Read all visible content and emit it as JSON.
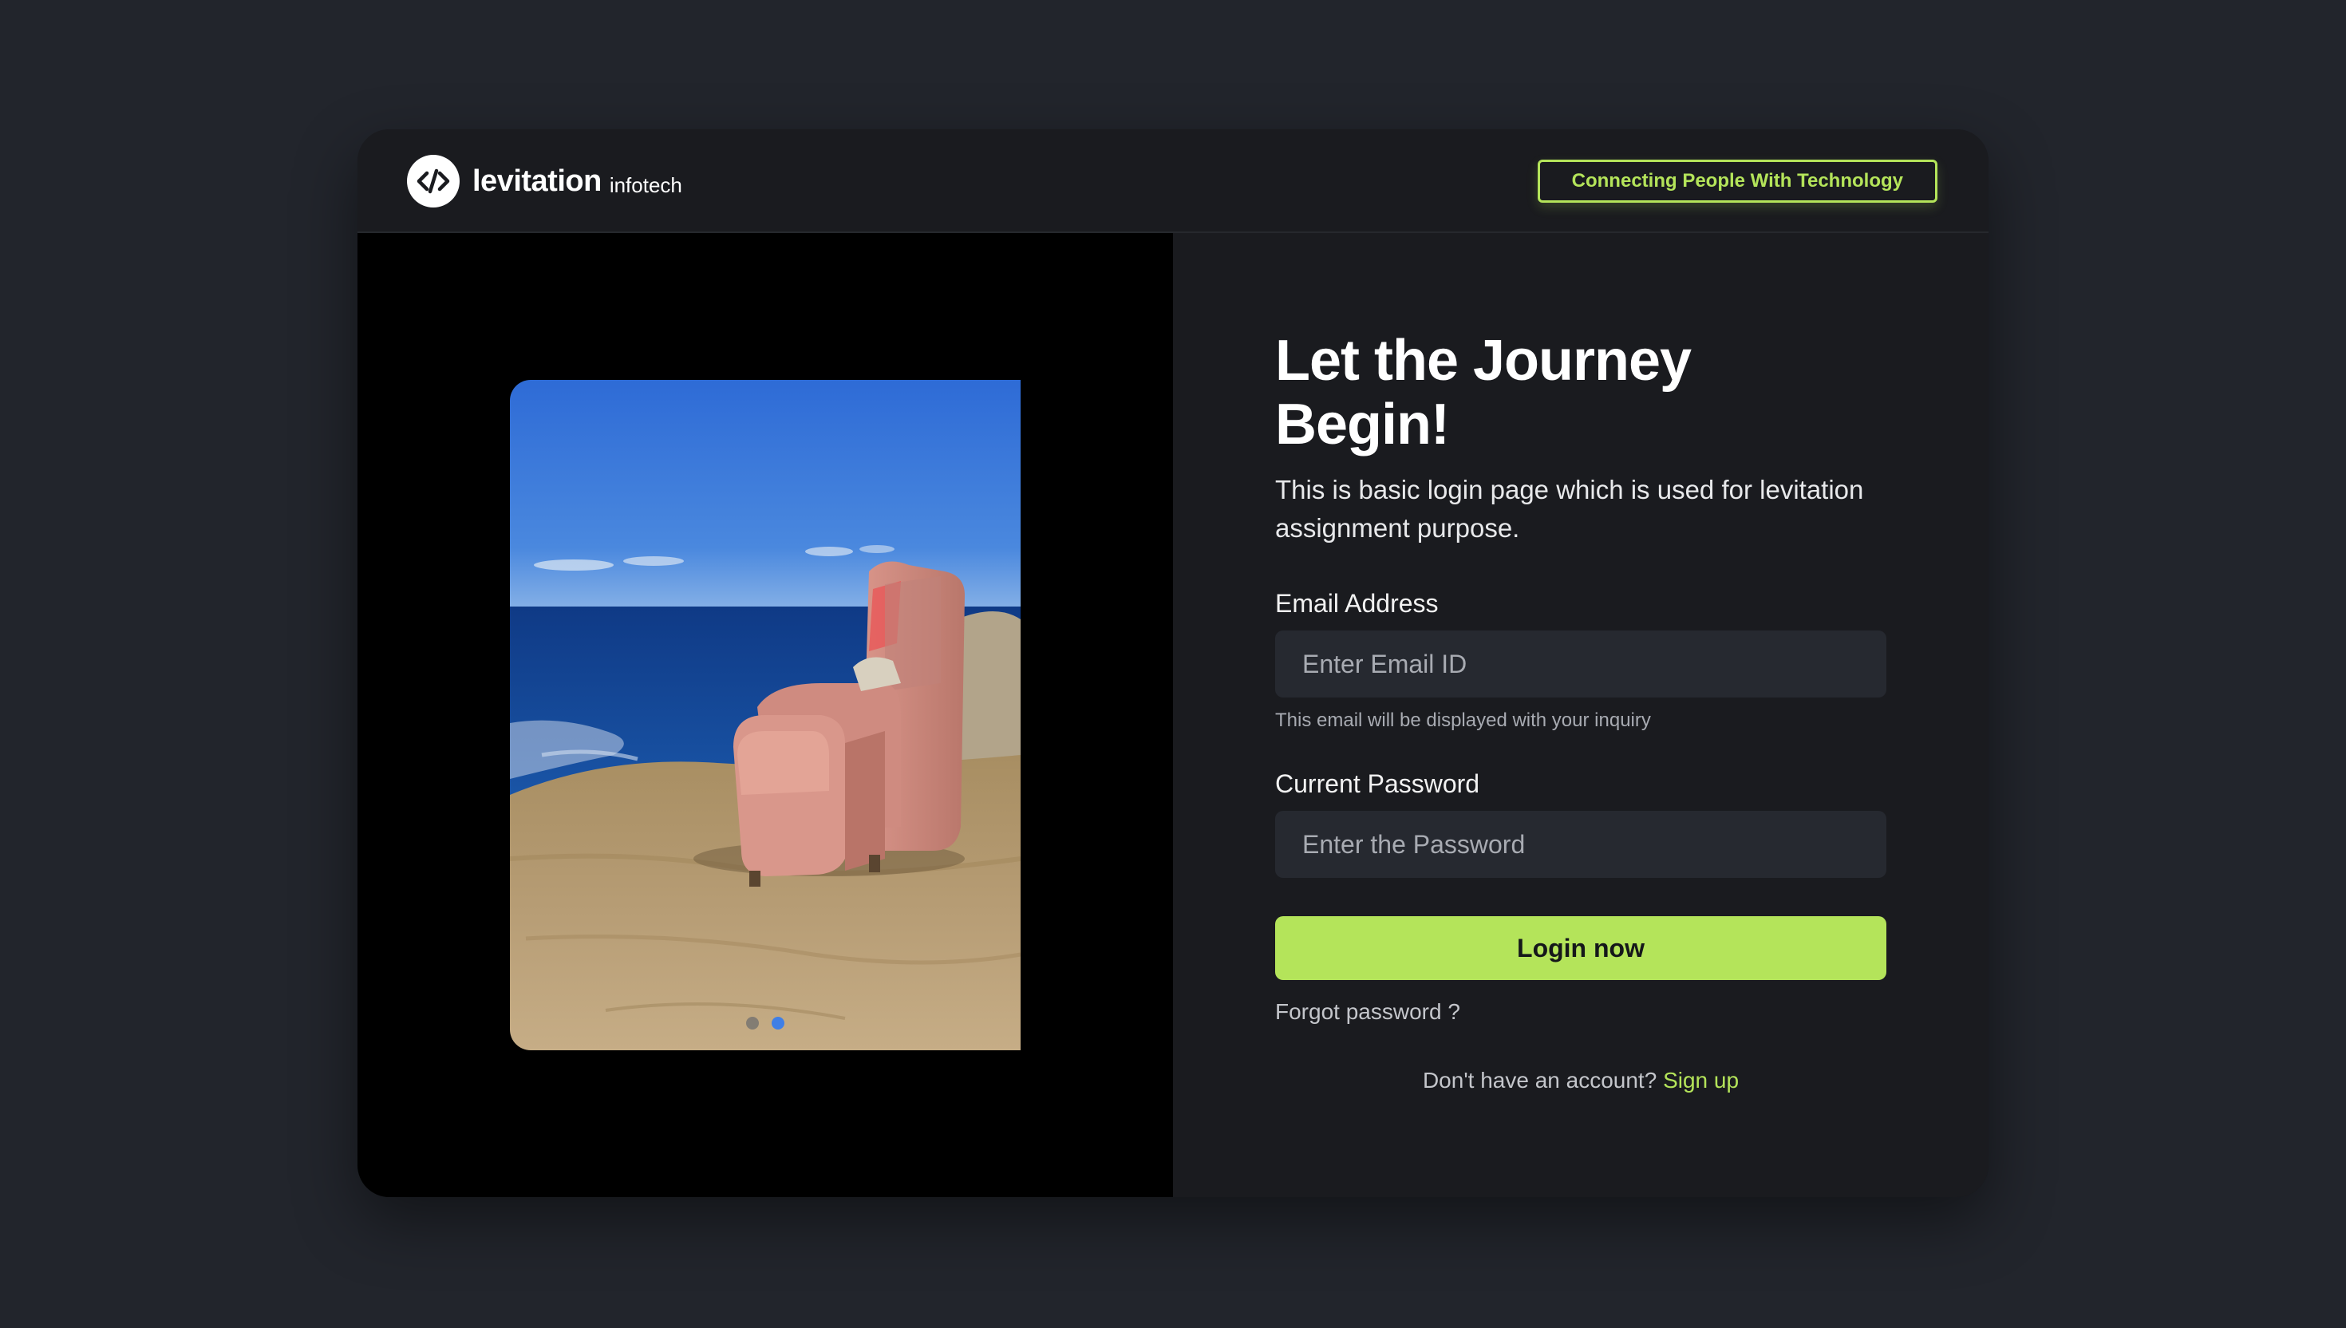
{
  "brand": {
    "name": "levitation",
    "sub": "infotech",
    "icon": "code-brackets-icon",
    "tagline": "Connecting People With Technology"
  },
  "carousel": {
    "image": "armchair-on-cliff-photo",
    "slide_count": 2,
    "active_slide": 2
  },
  "form": {
    "headline": "Let the Journey Begin!",
    "subtitle": "This is basic login page which is used for levitation assignment purpose.",
    "email": {
      "label": "Email Address",
      "placeholder": "Enter Email ID",
      "value": "",
      "hint": "This email will be displayed with your inquiry"
    },
    "password": {
      "label": "Current Password",
      "placeholder": "Enter the Password",
      "value": ""
    },
    "login_label": "Login now",
    "forgot_label": "Forgot password ?",
    "signup_prompt": "Don't have an account?",
    "signup_label": "Sign up"
  },
  "colors": {
    "accent": "#b4e45a",
    "background": "#22252c",
    "card": "#1a1b1f",
    "input": "#262930",
    "active_dot": "#3f7fe6"
  }
}
